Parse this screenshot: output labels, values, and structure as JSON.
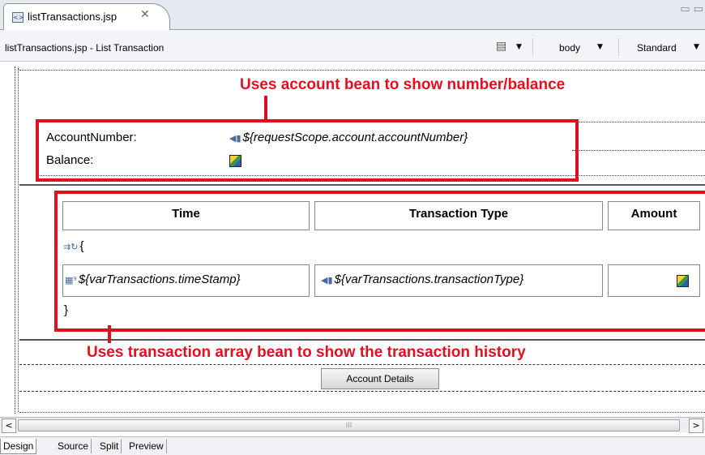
{
  "editor": {
    "tab_title": "listTransactions.jsp",
    "tab_close": "✕",
    "window_controls": "▭ ▭",
    "title": "listTransactions.jsp - List Transaction",
    "tag_value": "body",
    "mode_value": "Standard"
  },
  "callouts": {
    "top": "Uses account bean to show number/balance",
    "bottom": "Uses transaction array bean to show the transaction history"
  },
  "account": {
    "number_label": "AccountNumber:",
    "number_expr": "${requestScope.account.accountNumber}",
    "balance_label": "Balance:"
  },
  "table": {
    "headers": [
      "Time",
      "Transaction Type",
      "Amount"
    ],
    "loop_open": "{",
    "row_time": "${varTransactions.timeStamp}",
    "row_type": "${varTransactions.transactionType}",
    "loop_close": "}"
  },
  "buttons": {
    "account_details": "Account Details"
  },
  "scrollbar": {
    "left_arrow": "<",
    "right_arrow": ">",
    "thumb_grip": "III"
  },
  "bottom_tabs": [
    "Design",
    "Source",
    "Split",
    "Preview"
  ]
}
